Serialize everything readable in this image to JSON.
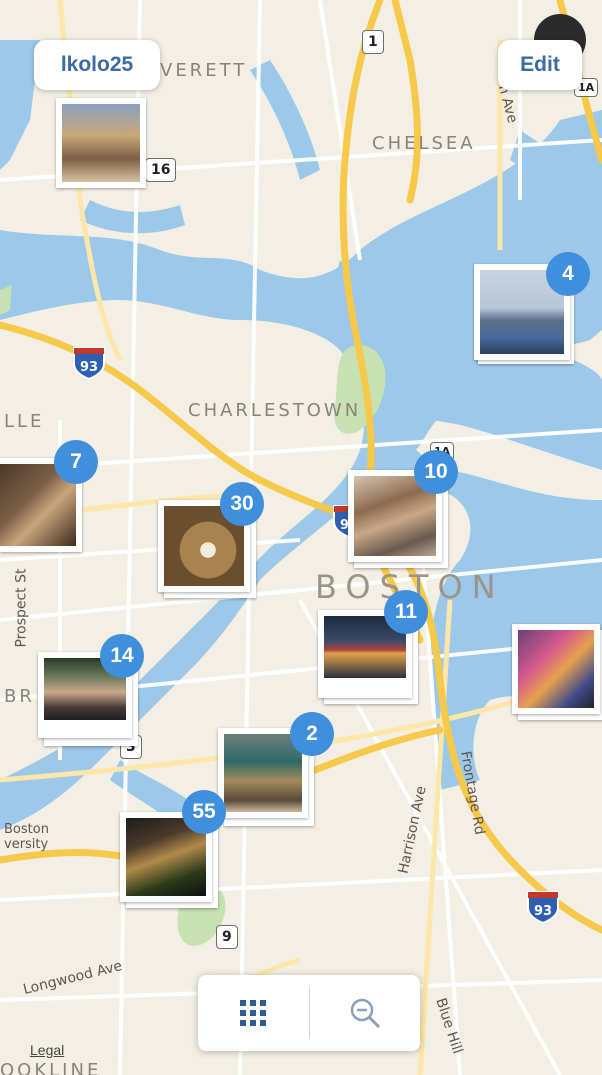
{
  "header": {
    "user_label": "lkolo25",
    "edit_label": "Edit"
  },
  "map": {
    "places": {
      "everett": "VERETT",
      "chelsea": "CHELSEA",
      "charlestown": "CHARLESTOWN",
      "boston": "BOSTON",
      "somerville_partial": "LLE",
      "brookline_partial": "BR",
      "brookline_bottom": "OOKLINE",
      "boston_university": "Boston\nversity"
    },
    "streets": {
      "prospect": "Prospect St",
      "harrison": "Harrison Ave",
      "frontage": "Frontage Rd",
      "longwood": "Longwood Ave",
      "blue_hill": "Blue Hill",
      "rte_ave": "n Ave"
    },
    "shields": {
      "i93_top": "93",
      "i93_center": "93",
      "i93_bottom": "93",
      "route_1": "1",
      "route_16": "16",
      "route_3": "3",
      "route_9": "9",
      "route_1a_top": "1A",
      "route_1a_center": "1A"
    },
    "legal_label": "Legal",
    "colors": {
      "land": "#f4efe4",
      "water": "#9cc9ea",
      "highway": "#f6c94a",
      "badge": "#3f8fdc",
      "button_text": "#3c6aa4"
    }
  },
  "clusters": [
    {
      "count": "",
      "photo": "shelves"
    },
    {
      "count": "4",
      "photo": "harbor"
    },
    {
      "count": "7",
      "photo": "dog"
    },
    {
      "count": "30",
      "photo": "baseball"
    },
    {
      "count": "10",
      "photo": "girl"
    },
    {
      "count": "11",
      "photo": "night-lights"
    },
    {
      "count": "",
      "photo": "mural"
    },
    {
      "count": "14",
      "photo": "group"
    },
    {
      "count": "2",
      "photo": "painting"
    },
    {
      "count": "55",
      "photo": "cafe"
    }
  ],
  "toolbar": {
    "grid_icon": "grid-icon",
    "zoom_icon": "zoom-out-icon"
  }
}
